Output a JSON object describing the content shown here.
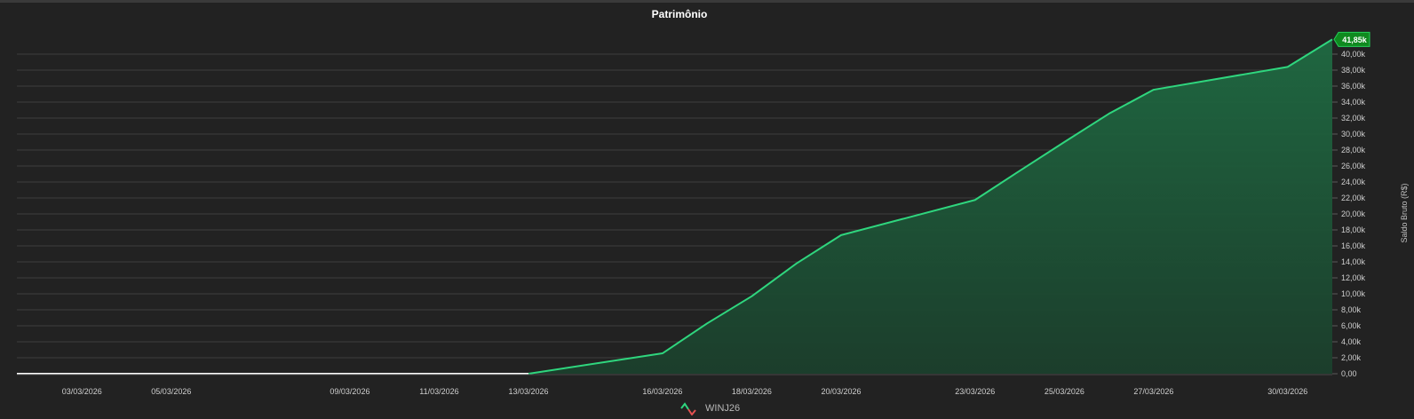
{
  "chart_data": {
    "type": "area",
    "title": "Patrimônio",
    "ylabel": "Saldo Bruto (R$)",
    "xlabel": "",
    "ylim": [
      0,
      41850
    ],
    "grid": true,
    "y_ticks": [
      "0,00",
      "2,00k",
      "4,00k",
      "6,00k",
      "8,00k",
      "10,00k",
      "12,00k",
      "14,00k",
      "16,00k",
      "18,00k",
      "20,00k",
      "22,00k",
      "24,00k",
      "26,00k",
      "28,00k",
      "30,00k",
      "32,00k",
      "34,00k",
      "36,00k",
      "38,00k",
      "40,00k"
    ],
    "y_tick_values": [
      0,
      2000,
      4000,
      6000,
      8000,
      10000,
      12000,
      14000,
      16000,
      18000,
      20000,
      22000,
      24000,
      26000,
      28000,
      30000,
      32000,
      34000,
      36000,
      38000,
      40000
    ],
    "x_ticks": [
      "03/03/2026",
      "05/03/2026",
      "09/03/2026",
      "11/03/2026",
      "13/03/2026",
      "16/03/2026",
      "18/03/2026",
      "20/03/2026",
      "23/03/2026",
      "25/03/2026",
      "27/03/2026",
      "30/03/2026"
    ],
    "series": [
      {
        "name": "WINJ26",
        "x": [
          "02/03/2026",
          "03/03/2026",
          "04/03/2026",
          "05/03/2026",
          "06/03/2026",
          "09/03/2026",
          "10/03/2026",
          "11/03/2026",
          "12/03/2026",
          "13/03/2026",
          "16/03/2026",
          "17/03/2026",
          "18/03/2026",
          "19/03/2026",
          "20/03/2026",
          "23/03/2026",
          "24/03/2026",
          "25/03/2026",
          "26/03/2026",
          "27/03/2026",
          "30/03/2026",
          "31/03/2026"
        ],
        "values": [
          0,
          0,
          0,
          0,
          0,
          0,
          0,
          0,
          0,
          0,
          2550,
          6300,
          9700,
          13800,
          17350,
          21750,
          25400,
          29000,
          32550,
          35550,
          38400,
          41850
        ]
      }
    ],
    "last_value_label": "41,85k",
    "colors": {
      "line": "#2fd67e",
      "fill": "#1e5f3c",
      "zero_line": "#ffffff",
      "badge_bg": "#0f8a1f",
      "badge_border": "#25d05a",
      "loss": "#e35050"
    }
  },
  "legend": {
    "label": "WINJ26",
    "icon": "up-down-line-icon"
  }
}
